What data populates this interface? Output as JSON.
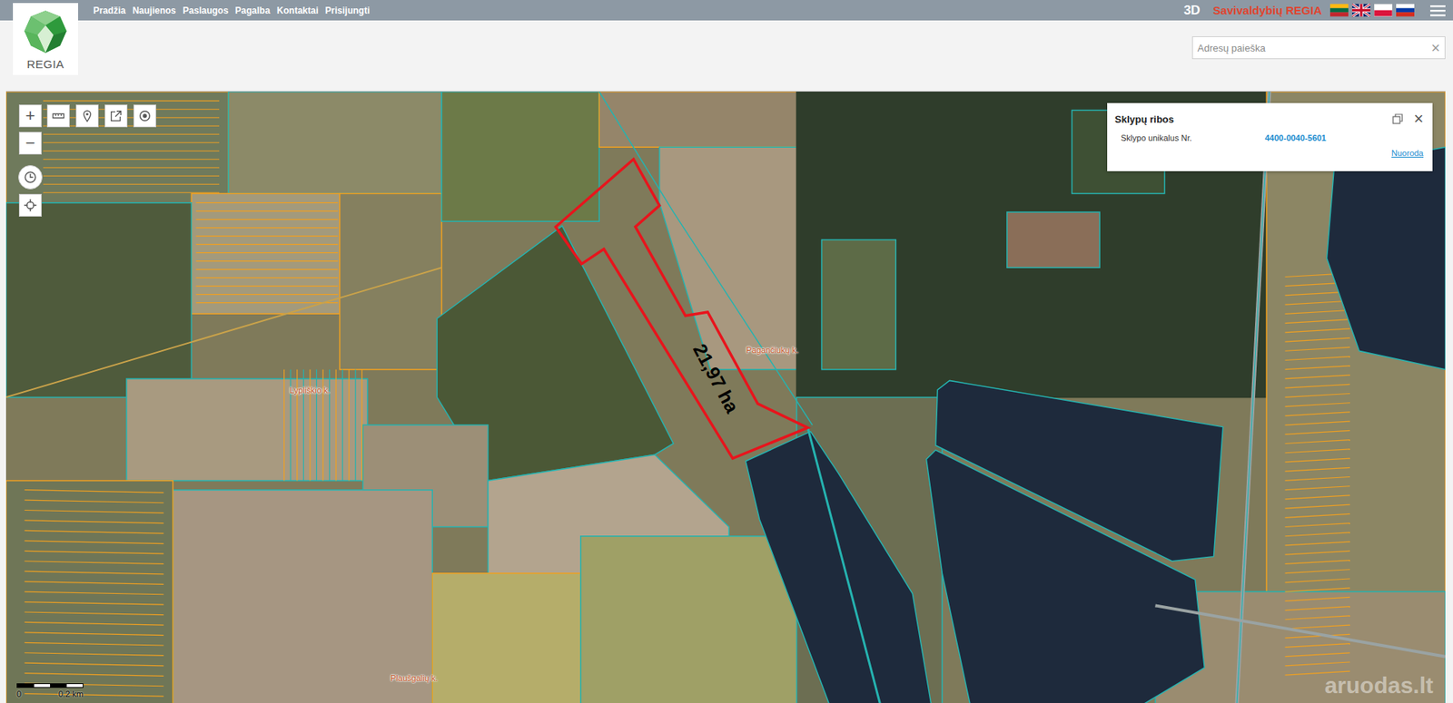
{
  "topbar": {
    "nav": [
      "Pradžia",
      "Naujienos",
      "Paslaugos",
      "Pagalba",
      "Kontaktai",
      "Prisijungti"
    ],
    "mode_3d": "3D",
    "brand": "Savivaldybių REGIA"
  },
  "logo": {
    "text": "REGIA"
  },
  "search": {
    "placeholder": "Adresų paieška",
    "clear_icon": "×"
  },
  "controls": {
    "zoom_in": "+",
    "zoom_out": "−"
  },
  "map": {
    "parcel_area": "21,97 ha",
    "labels": [
      "Lypliškio k.",
      "Pagančiukų k.",
      "Plaušgalių k."
    ],
    "scale": {
      "start": "0",
      "end": "0.2 km"
    },
    "watermark": "aruodas.lt"
  },
  "popup": {
    "title": "Sklypų ribos",
    "field_label": "Sklypo unikalus Nr.",
    "field_value": "4400-0040-5601",
    "link": "Nuoroda",
    "close_icon": "×"
  }
}
